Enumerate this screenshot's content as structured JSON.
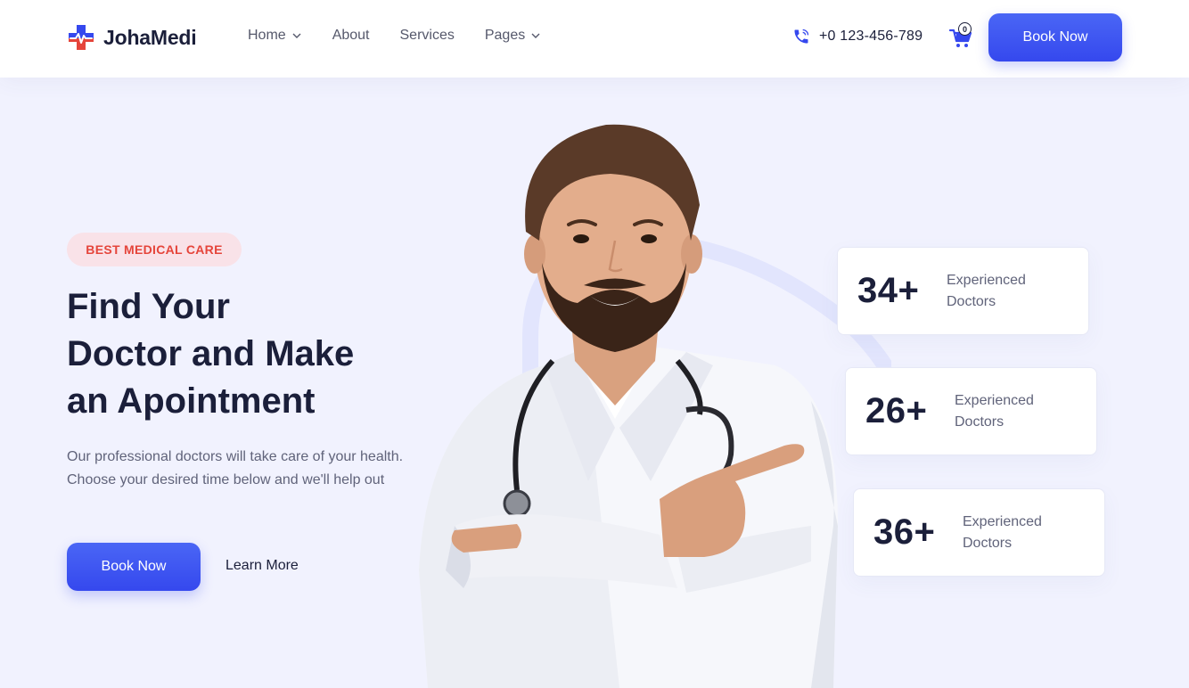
{
  "brand": {
    "name": "JohaMedi"
  },
  "nav": {
    "items": [
      {
        "label": "Home",
        "has_dropdown": true
      },
      {
        "label": "About",
        "has_dropdown": false
      },
      {
        "label": "Services",
        "has_dropdown": false
      },
      {
        "label": "Pages",
        "has_dropdown": true
      }
    ]
  },
  "header": {
    "phone": "+0 123-456-789",
    "cart_count": "0",
    "book_label": "Book Now"
  },
  "hero": {
    "badge": "BEST MEDICAL CARE",
    "title_lines": [
      "Find Your",
      "Doctor and Make",
      "an Apointment"
    ],
    "description": "Our professional doctors will take care of your health. Choose your desired time below and we'll help out",
    "primary_button": "Book Now",
    "secondary_link": "Learn More"
  },
  "stats": [
    {
      "value": "34+",
      "label_line1": "Experienced",
      "label_line2": "Doctors"
    },
    {
      "value": "26+",
      "label_line1": "Experienced",
      "label_line2": "Doctors"
    },
    {
      "value": "36+",
      "label_line1": "Experienced",
      "label_line2": "Doctors"
    }
  ],
  "icons": {
    "logo": "medical-cross-logo-icon",
    "phone": "phone-icon",
    "cart": "cart-icon",
    "dropdown": "chevron-down-icon"
  },
  "colors": {
    "primary": "#3f57f2",
    "badge_bg": "#f9e2e8",
    "badge_text": "#e5453b",
    "page_bg": "#f1f2fe",
    "heading": "#1b1f3a"
  }
}
